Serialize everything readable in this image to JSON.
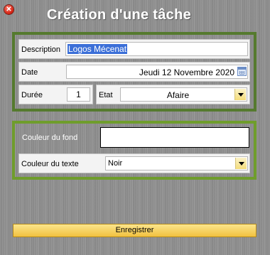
{
  "window": {
    "title": "Création d'une tâche",
    "close_icon": "close-icon"
  },
  "form": {
    "description_label": "Description",
    "description_value": "Logos Mécenat",
    "date_label": "Date",
    "date_value": "Jeudi 12 Novembre 2020",
    "duration_label": "Durée",
    "duration_value": "1",
    "state_label": "Etat",
    "state_value": "Afaire",
    "bg_color_label": "Couleur du fond",
    "bg_color_value": "",
    "text_color_label": "Couleur du texte",
    "text_color_value": "Noir"
  },
  "actions": {
    "save_label": "Enregistrer"
  },
  "colors": {
    "group_border": "#557a2e",
    "button_top": "#fbe58c",
    "button_bottom": "#f2c13f",
    "selection": "#3b6fd8"
  }
}
